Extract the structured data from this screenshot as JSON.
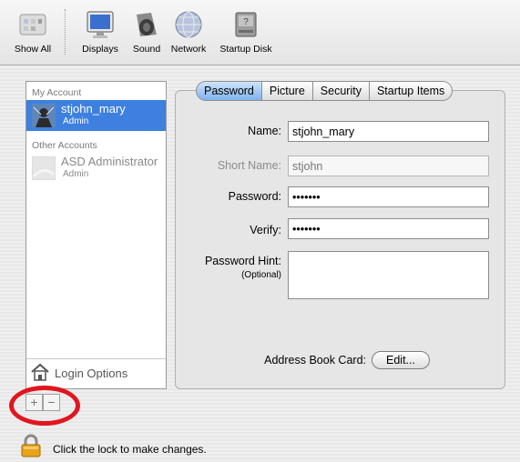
{
  "toolbar": {
    "items": [
      {
        "label": "Show All",
        "icon": "show-all-icon"
      },
      {
        "label": "Displays",
        "icon": "display-icon"
      },
      {
        "label": "Sound",
        "icon": "speaker-icon"
      },
      {
        "label": "Network",
        "icon": "network-globe-icon"
      },
      {
        "label": "Startup Disk",
        "icon": "hard-disk-icon"
      }
    ]
  },
  "accounts": {
    "my_account_header": "My Account",
    "my_account": {
      "name": "stjohn_mary",
      "role": "Admin",
      "selected": true
    },
    "other_accounts_header": "Other Accounts",
    "other_accounts": [
      {
        "name": "ASD Administrator",
        "role": "Admin"
      }
    ],
    "login_options": "Login Options",
    "add_button": "+",
    "remove_button": "−"
  },
  "tabs": [
    "Password",
    "Picture",
    "Security",
    "Startup Items"
  ],
  "active_tab": "Password",
  "form": {
    "name_label": "Name:",
    "name_value": "stjohn_mary",
    "short_name_label": "Short Name:",
    "short_name_value": "stjohn",
    "password_label": "Password:",
    "password_value": "•••••••",
    "verify_label": "Verify:",
    "verify_value": "•••••••",
    "hint_label": "Password Hint:",
    "hint_optional": "(Optional)",
    "hint_value": "",
    "address_book_label": "Address Book Card:",
    "edit_button": "Edit..."
  },
  "lock": {
    "text": "Click the lock to make changes.",
    "state": "locked"
  },
  "colors": {
    "selection": "#3d80df",
    "active_tab": "#7fb2ec",
    "highlight_circle": "#e0161f",
    "lock": "#e8a31b"
  }
}
